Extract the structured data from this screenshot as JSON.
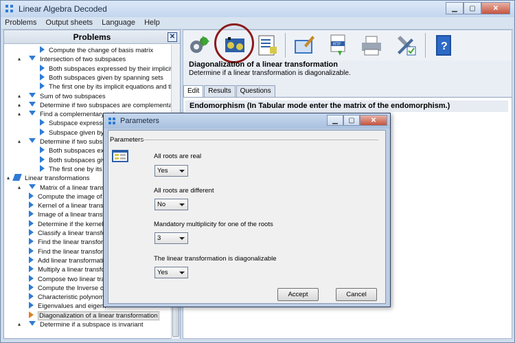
{
  "window": {
    "title": "Linear Algebra Decoded"
  },
  "menu": [
    "Problems",
    "Output sheets",
    "Language",
    "Help"
  ],
  "left_panel": {
    "header": "Problems",
    "items": [
      {
        "label": "Compute the change of basis matrix",
        "level": 2,
        "icon": "triangle-right"
      },
      {
        "label": "Intersection of two subspaces",
        "level": 1,
        "icon": "triangle-down"
      },
      {
        "label": "Both subspaces expressed by their implicit e",
        "level": 2,
        "icon": "triangle-right"
      },
      {
        "label": "Both subspaces given by spanning sets",
        "level": 2,
        "icon": "triangle-right"
      },
      {
        "label": "The first one by its implicit equations and the",
        "level": 2,
        "icon": "triangle-right"
      },
      {
        "label": "Sum of two subspaces",
        "level": 1,
        "icon": "triangle-down"
      },
      {
        "label": "Determine if two subspaces are complementary",
        "level": 1,
        "icon": "triangle-down"
      },
      {
        "label": "Find a complementary subspace",
        "level": 1,
        "icon": "triangle-down"
      },
      {
        "label": "Subspace expresse",
        "level": 2,
        "icon": "triangle-right"
      },
      {
        "label": "Subspace given by",
        "level": 2,
        "icon": "triangle-right"
      },
      {
        "label": "Determine if two subs",
        "level": 1,
        "icon": "triangle-down"
      },
      {
        "label": "Both subspaces exp",
        "level": 2,
        "icon": "triangle-right"
      },
      {
        "label": "Both subspaces giv",
        "level": 2,
        "icon": "triangle-right"
      },
      {
        "label": "The first one by its",
        "level": 2,
        "icon": "triangle-right"
      },
      {
        "label": "Linear transformations",
        "level": 0,
        "icon": "folder"
      },
      {
        "label": "Matrix of a linear transf",
        "level": 1,
        "icon": "triangle-down"
      },
      {
        "label": "Compute the image of a",
        "level": 1,
        "icon": "triangle-right"
      },
      {
        "label": "Kernel of a linear transf",
        "level": 1,
        "icon": "triangle-right"
      },
      {
        "label": "Image of a linear transfo",
        "level": 1,
        "icon": "triangle-right"
      },
      {
        "label": "Determine if the kernel",
        "level": 1,
        "icon": "triangle-right"
      },
      {
        "label": "Classify a linear transfo",
        "level": 1,
        "icon": "triangle-right"
      },
      {
        "label": "Find the linear transform",
        "level": 1,
        "icon": "triangle-right"
      },
      {
        "label": "Find the linear transform",
        "level": 1,
        "icon": "triangle-right"
      },
      {
        "label": "Add linear transformatio",
        "level": 1,
        "icon": "triangle-right"
      },
      {
        "label": "Multiply a linear transfo",
        "level": 1,
        "icon": "triangle-right"
      },
      {
        "label": "Compose two linear tran",
        "level": 1,
        "icon": "triangle-right"
      },
      {
        "label": "Compute the Inverse of",
        "level": 1,
        "icon": "triangle-right"
      },
      {
        "label": "Characteristic polynomia",
        "level": 1,
        "icon": "triangle-right"
      },
      {
        "label": "Eigenvalues and eigenv",
        "level": 1,
        "icon": "triangle-right"
      },
      {
        "label": "Diagonalization of a linear transformation",
        "level": 1,
        "icon": "triangle-right-selected"
      },
      {
        "label": "Determine if a subspace is invariant",
        "level": 1,
        "icon": "triangle-down"
      }
    ],
    "selected_label": "Diagonalization of a linear transformation"
  },
  "toolbar": {
    "buttons": [
      "gear-icon",
      "parameters-icon",
      "checklist-icon",
      "clear-icon",
      "rtf-export-icon",
      "print-icon",
      "tools-icon",
      "help-book-icon"
    ]
  },
  "section": {
    "title": "Diagonalization of a linear transformation",
    "subtitle": "Determine if a linear transformation is diagonalizable."
  },
  "tabs": [
    "Edit",
    "Results",
    "Questions"
  ],
  "active_tab": "Edit",
  "endomorphism_header": "Endomorphism (In Tabular mode enter the matrix of the endomorphism.)",
  "dialog": {
    "title": "Parameters",
    "group_label": "Parameters",
    "params": [
      {
        "label": "All roots are real",
        "value": "Yes"
      },
      {
        "label": "All roots are different",
        "value": "No"
      },
      {
        "label": "Mandatory multiplicity for one of the roots",
        "value": "3"
      },
      {
        "label": "The linear transformation is diagonalizable",
        "value": "Yes"
      }
    ],
    "accept_label": "Accept",
    "cancel_label": "Cancel"
  },
  "colors": {
    "accent": "#2e7cd6",
    "highlight_ring": "#8c1b1b",
    "selected_marker": "#e0801e"
  }
}
